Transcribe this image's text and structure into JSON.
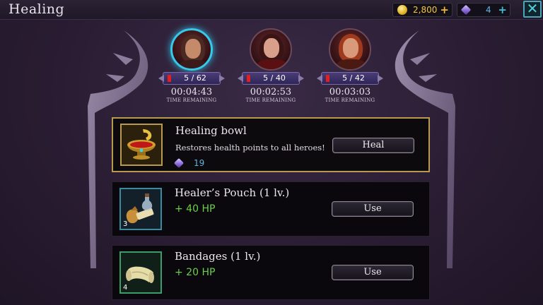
{
  "header": {
    "title": "Healing"
  },
  "currency": {
    "gold": "2,800",
    "gems": "4",
    "plus": "+"
  },
  "close": {
    "symbol": "✕"
  },
  "heroes": [
    {
      "hp": "5 / 62",
      "time": "00:04:43",
      "time_label": "TIME REMAINING",
      "hair_color": "#4a2a22",
      "active": true
    },
    {
      "hp": "5 / 40",
      "time": "00:02:53",
      "time_label": "TIME REMAINING",
      "hair_color": "#3a1414",
      "active": false
    },
    {
      "hp": "5 / 42",
      "time": "00:03:03",
      "time_label": "TIME REMAINING",
      "hair_color": "#a03a1e",
      "active": false
    }
  ],
  "items": [
    {
      "name": "Healing bowl",
      "description": "Restores health points to all heroes!",
      "cost": "19",
      "button": "Heal",
      "icon": "healing-bowl-icon"
    },
    {
      "name": "Healer’s Pouch (1 lv.)",
      "effect": "+ 40 HP",
      "count": "3",
      "button": "Use",
      "icon": "pouch-icon"
    },
    {
      "name": "Bandages (1 lv.)",
      "effect": "+ 20 HP",
      "count": "4",
      "button": "Use",
      "icon": "bandage-scroll-icon"
    }
  ],
  "colors": {
    "accent": "#38c8e8",
    "gold": "#f2c640",
    "hp_green": "#6ad04a",
    "selected_border": "#b89a4e"
  }
}
